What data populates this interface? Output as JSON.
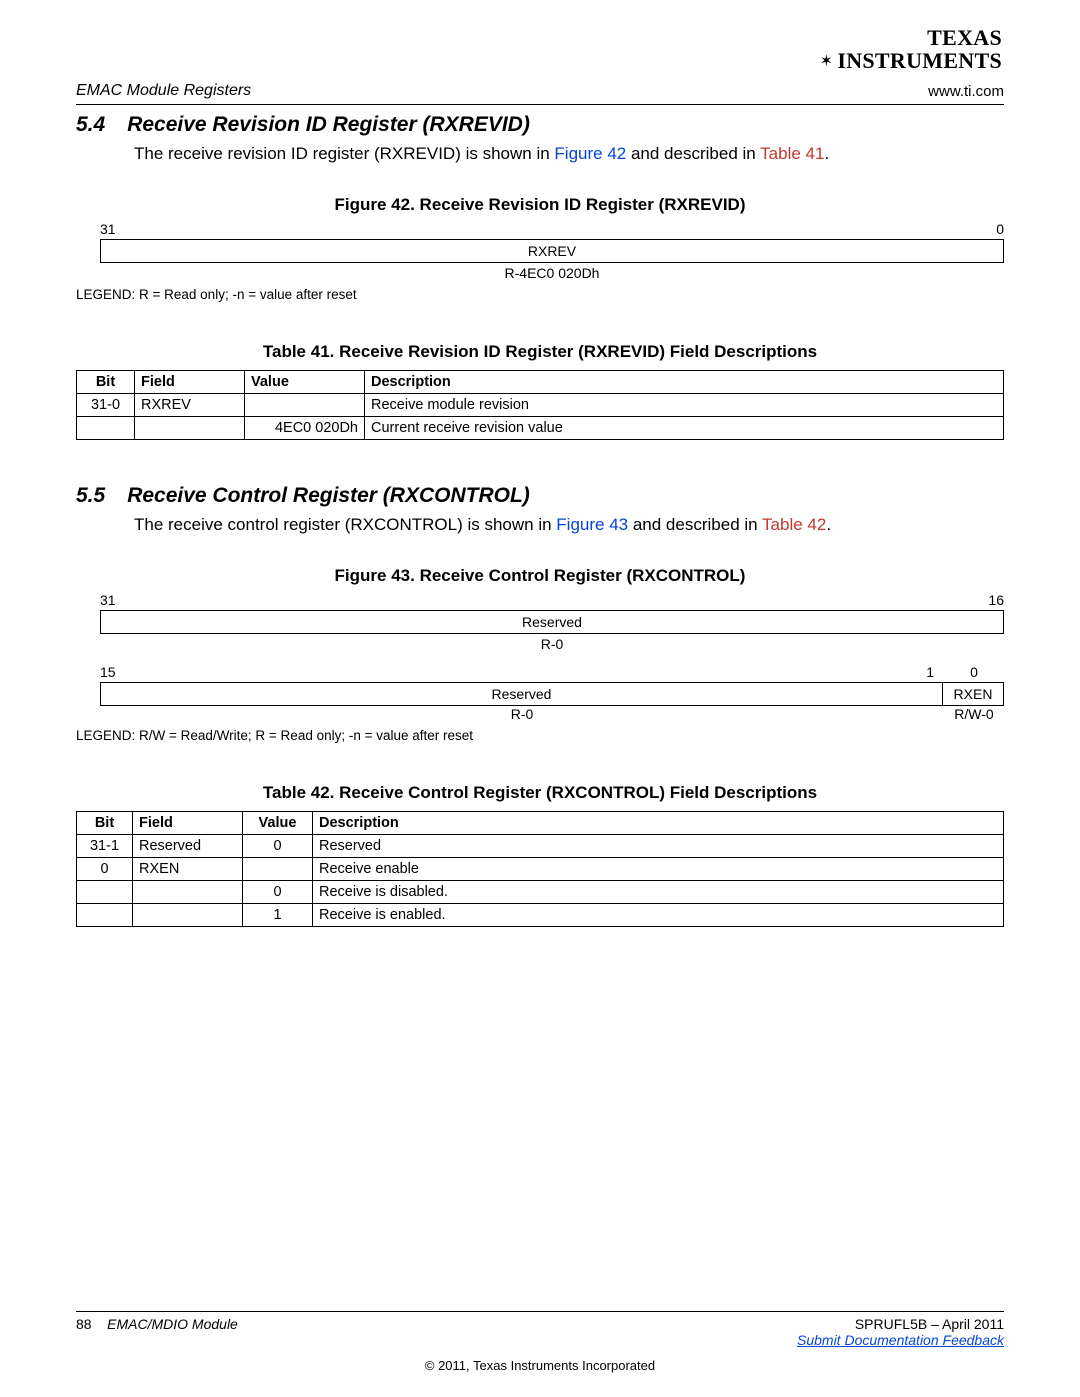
{
  "brand": {
    "line1": "TEXAS",
    "line2": "INSTRUMENTS"
  },
  "running": {
    "left": "EMAC Module Registers",
    "right": "www.ti.com"
  },
  "sec54": {
    "num": "5.4",
    "title": "Receive Revision ID Register (RXREVID)",
    "para_pre": "The receive revision ID register (RXREVID) is shown in ",
    "fig_link": "Figure 42",
    "para_mid": " and described in ",
    "tbl_link": "Table 41",
    "dot": ".",
    "figcap": "Figure 42. Receive Revision ID Register (RXREVID)",
    "bitL": "31",
    "bitR": "0",
    "field": "RXREV",
    "reset": "R-4EC0 020Dh",
    "legend": "LEGEND: R = Read only; -n = value after reset",
    "tblcap": "Table 41. Receive Revision ID Register (RXREVID) Field Descriptions",
    "headers": {
      "bit": "Bit",
      "field": "Field",
      "value": "Value",
      "desc": "Description"
    },
    "rows": [
      {
        "bit": "31-0",
        "field": "RXREV",
        "value": "",
        "desc": "Receive module revision"
      },
      {
        "bit": "",
        "field": "",
        "value": "4EC0 020Dh",
        "desc": "Current receive revision value"
      }
    ]
  },
  "sec55": {
    "num": "5.5",
    "title": "Receive Control Register (RXCONTROL)",
    "para_pre": "The receive control register (RXCONTROL) is shown in ",
    "fig_link": "Figure 43",
    "para_mid": " and described in ",
    "tbl_link": "Table 42",
    "dot": ".",
    "figcap": "Figure 43. Receive Control Register (RXCONTROL)",
    "bits1": {
      "l": "31",
      "r": "16"
    },
    "row1": {
      "field": "Reserved",
      "reset": "R-0"
    },
    "bits2": {
      "l": "15",
      "m": "1",
      "r": "0"
    },
    "row2": {
      "fieldL": "Reserved",
      "resetL": "R-0",
      "fieldR": "RXEN",
      "resetR": "R/W-0"
    },
    "legend": "LEGEND: R/W = Read/Write; R = Read only; -n = value after reset",
    "tblcap": "Table 42. Receive Control Register (RXCONTROL) Field Descriptions",
    "headers": {
      "bit": "Bit",
      "field": "Field",
      "value": "Value",
      "desc": "Description"
    },
    "rows": [
      {
        "bit": "31-1",
        "field": "Reserved",
        "value": "0",
        "desc": "Reserved"
      },
      {
        "bit": "0",
        "field": "RXEN",
        "value": "",
        "desc": "Receive enable"
      },
      {
        "bit": "",
        "field": "",
        "value": "0",
        "desc": "Receive is disabled."
      },
      {
        "bit": "",
        "field": "",
        "value": "1",
        "desc": "Receive is enabled."
      }
    ]
  },
  "footer": {
    "page": "88",
    "module": "EMAC/MDIO Module",
    "doc": "SPRUFL5B – April 2011",
    "feedback": "Submit Documentation Feedback",
    "copy": "© 2011, Texas Instruments Incorporated"
  }
}
